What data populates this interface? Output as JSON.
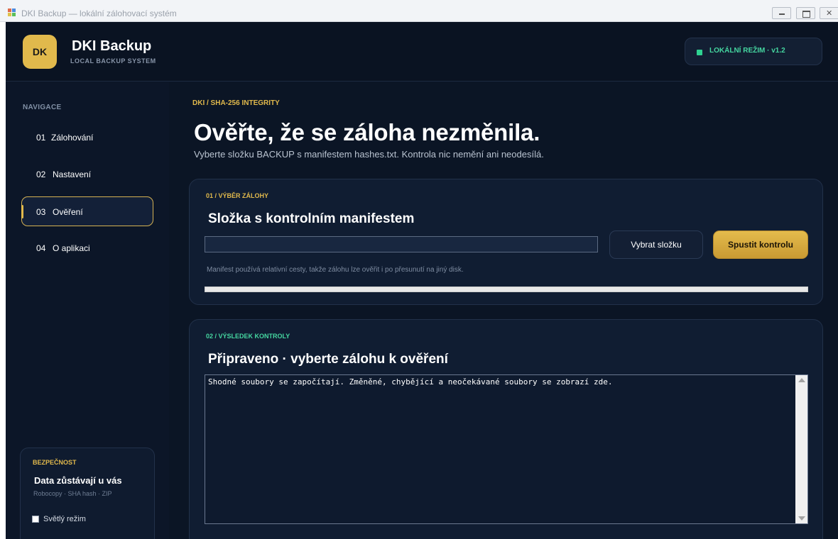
{
  "window": {
    "title": "DKI Backup — lokální zálohovací systém"
  },
  "header": {
    "logo_text": "DK",
    "app_name": "DKI Backup",
    "app_subtitle": "LOCAL BACKUP SYSTEM",
    "mode_label": "LOKÁLNÍ REŽIM  ·  v1.2"
  },
  "sidebar": {
    "heading": "NAVIGACE",
    "items": [
      {
        "num": "01",
        "label": "Zálohování",
        "active": false
      },
      {
        "num": "02",
        "label": "Nastavení",
        "active": false
      },
      {
        "num": "03",
        "label": "Ověření",
        "active": true
      },
      {
        "num": "04",
        "label": "O aplikaci",
        "active": false
      }
    ],
    "security": {
      "title": "BEZPEČNOST",
      "heading": "Data zůstávají u vás",
      "sub": "Robocopy · SHA hash · ZIP",
      "light_mode_label": "Světlý režim",
      "light_mode_checked": false
    }
  },
  "main": {
    "eyebrow": "DKI / SHA-256 INTEGRITY",
    "title": "Ověřte, že se záloha nezměnila.",
    "subtitle": "Vyberte složku BACKUP s manifestem hashes.txt. Kontrola nic nemění ani neodesílá.",
    "selection_card": {
      "step": "01 / VÝBĚR ZÁLOHY",
      "title": "Složka s kontrolním manifestem",
      "path_value": "",
      "choose_button": "Vybrat složku",
      "run_button": "Spustit kontrolu",
      "hint": "Manifest používá relativní cesty, takže zálohu lze ověřit i po přesunutí na jiný disk.",
      "progress": 0
    },
    "result_card": {
      "step": "02 / VÝSLEDEK KONTROLY",
      "title": "Připraveno · vyberte zálohu k ověření",
      "output_text": "Shodné soubory se započítají. Změněné, chybějící a neočekávané soubory se zobrazí zde."
    }
  },
  "colors": {
    "accent": "#e1b94c",
    "success": "#2fd291",
    "background": "#0b1525"
  }
}
